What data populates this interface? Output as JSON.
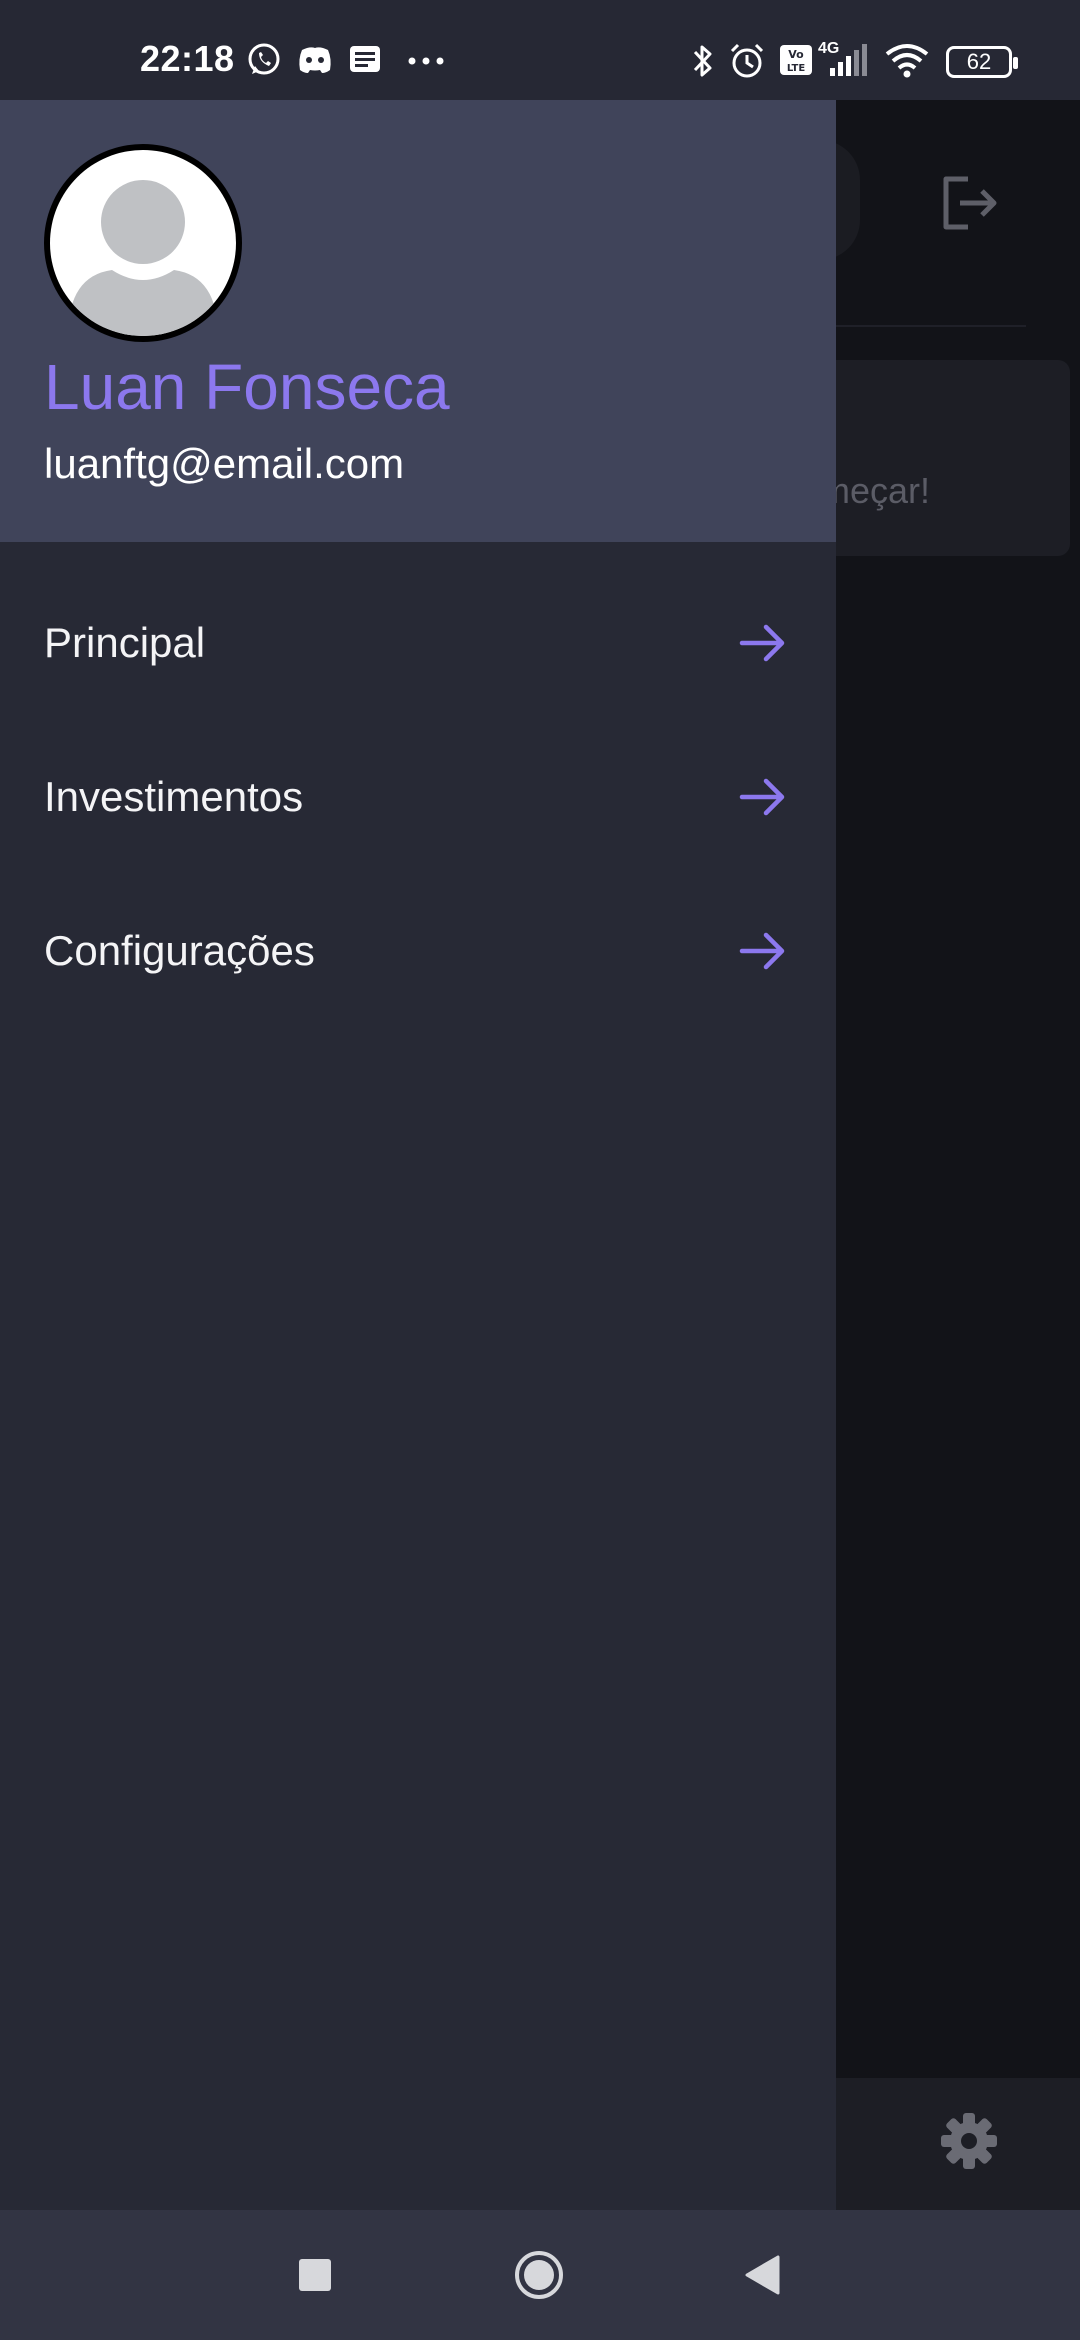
{
  "status_bar": {
    "time": "22:18",
    "battery_level": "62",
    "network_label": "4G",
    "left_icons": [
      "whatsapp-icon",
      "discord-icon",
      "news-icon",
      "more-notifications-icon"
    ],
    "right_icons": [
      "bluetooth-icon",
      "alarm-icon",
      "volte-icon",
      "signal-icon",
      "wifi-icon",
      "battery-icon"
    ]
  },
  "background_app": {
    "card_text_fragment": "meçar!",
    "icons": [
      "logout-icon",
      "settings-gear-icon"
    ]
  },
  "drawer": {
    "user": {
      "name": "Luan Fonseca",
      "email": "luanftg@email.com"
    },
    "menu": [
      {
        "label": "Principal",
        "icon": "arrow-right-icon"
      },
      {
        "label": "Investimentos",
        "icon": "arrow-right-icon"
      },
      {
        "label": "Configurações",
        "icon": "arrow-right-icon"
      }
    ]
  },
  "colors": {
    "accent": "#8c78ee",
    "drawer_header": "#40445a",
    "drawer_body": "#272935",
    "nav_bar": "#323443"
  },
  "nav_bar": {
    "buttons": [
      "recents-square-icon",
      "home-circle-icon",
      "back-triangle-icon"
    ]
  }
}
